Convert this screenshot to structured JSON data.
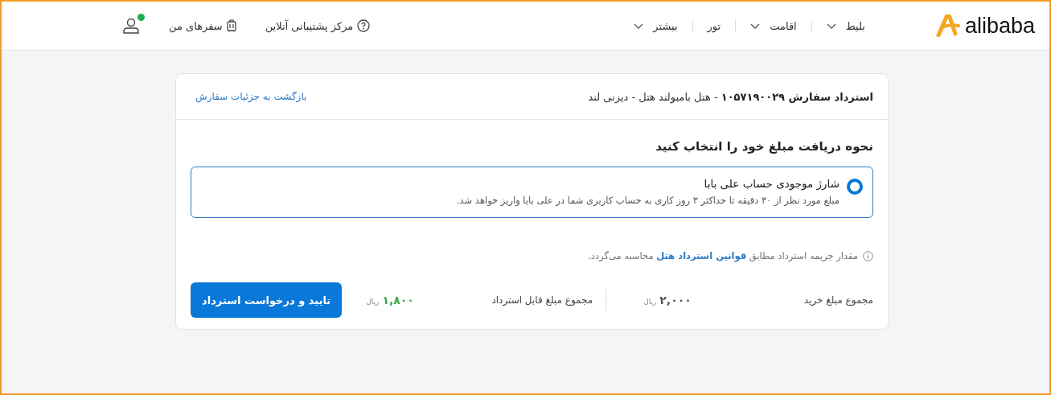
{
  "header": {
    "logo": "alibaba",
    "nav": [
      {
        "label": "بلیط",
        "dropdown": true
      },
      {
        "label": "اقامت",
        "dropdown": true
      },
      {
        "label": "تور",
        "dropdown": false
      },
      {
        "label": "بیشتر",
        "dropdown": true
      }
    ],
    "support": "مرکز پشتیبانی آنلاین",
    "trips": "سفرهای من",
    "user_verified": true
  },
  "card": {
    "title": "**استرداد سفارش ۱۰۵۷۱۹۰۰۲۹** - هتل بامبولند هتل - دیزنی لند",
    "back_link": "بازگشت به جزئیات سفارش",
    "heading": "نحوه دریافت مبلغ خود را انتخاب کنید",
    "options": [
      {
        "title": "شارژ موجودی حساب علی بابا",
        "description": "مبلغ مورد نظر از ۳۰ دقیقه تا حداکثر ۳ روز کاری به حساب کاربری شما در علی بابا واریز خواهد شد.",
        "selected": true
      }
    ],
    "note": {
      "before": "مقدار جریمه استرداد مطابق",
      "link": "قوانین استرداد هتل",
      "after": "محاسبه می‌گردد."
    },
    "summary": [
      {
        "label": "مجموع مبلغ خرید",
        "amount": "۲,۰۰۰",
        "currency": "ریال",
        "highlight": false
      },
      {
        "label": "مجموع مبلغ قابل استرداد",
        "amount": "۱,۸۰۰",
        "currency": "ریال",
        "highlight": true
      }
    ],
    "submit": "تایید و درخواست استرداد"
  }
}
